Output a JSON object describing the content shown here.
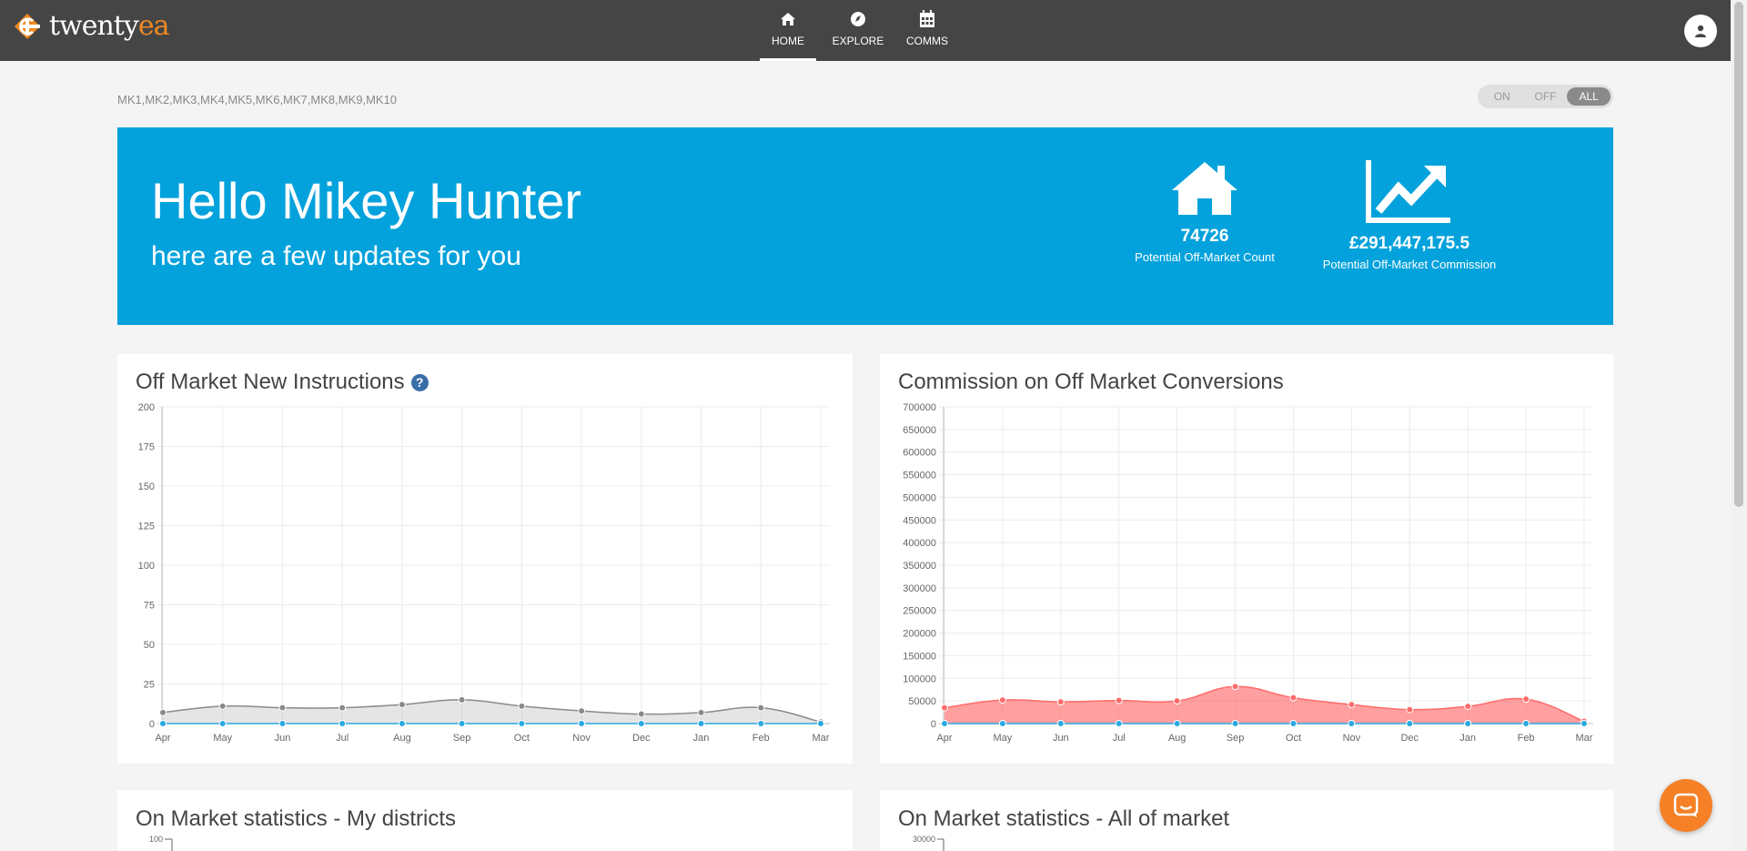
{
  "app": {
    "logo_word": "twenty",
    "logo_accent": "ea"
  },
  "nav": [
    {
      "label": "HOME",
      "icon": "home-icon",
      "active": true
    },
    {
      "label": "EXPLORE",
      "icon": "compass-icon",
      "active": false
    },
    {
      "label": "COMMS",
      "icon": "calendar-icon",
      "active": false
    }
  ],
  "filters": {
    "districts": "MK1,MK2,MK3,MK4,MK5,MK6,MK7,MK8,MK9,MK10",
    "toggle_options": [
      "ON",
      "OFF",
      "ALL"
    ],
    "toggle_selected": "ALL"
  },
  "hero": {
    "greeting": "Hello Mikey Hunter",
    "subtitle": "here are a few updates for you",
    "stats": [
      {
        "icon": "house-icon",
        "value": "74726",
        "label": "Potential Off-Market Count"
      },
      {
        "icon": "trend-up-icon",
        "value": "£291,447,175.5",
        "label": "Potential Off-Market Commission"
      }
    ]
  },
  "cards": {
    "off_market_title": "Off Market New Instructions",
    "commission_title": "Commission on Off Market Conversions",
    "my_districts_title": "On Market statistics - My districts",
    "all_market_title": "On Market statistics - All of market",
    "my_districts_first_tick": "100",
    "all_market_first_tick": "30000"
  },
  "colors": {
    "hero_bg": "#04a2dc",
    "topbar": "#454545",
    "chart1_line": "#8a8a8a",
    "chart2_line": "#ff6b6b",
    "baseline_series": "#2aa9e0",
    "chat_button": "#f58025"
  },
  "chart_data": [
    {
      "type": "area",
      "title": "Off Market New Instructions",
      "categories": [
        "Apr",
        "May",
        "Jun",
        "Jul",
        "Aug",
        "Sep",
        "Oct",
        "Nov",
        "Dec",
        "Jan",
        "Feb",
        "Mar"
      ],
      "ylim": [
        0,
        200
      ],
      "yticks": [
        0,
        25,
        50,
        75,
        100,
        125,
        150,
        175,
        200
      ],
      "grid": true,
      "series": [
        {
          "values": [
            7,
            11,
            10,
            10,
            12,
            15,
            11,
            8,
            6,
            7,
            10,
            1
          ],
          "color": "#8a8a8a"
        },
        {
          "values": [
            0,
            0,
            0,
            0,
            0,
            0,
            0,
            0,
            0,
            0,
            0,
            0
          ],
          "color": "#2aa9e0"
        }
      ]
    },
    {
      "type": "area",
      "title": "Commission on Off Market Conversions",
      "categories": [
        "Apr",
        "May",
        "Jun",
        "Jul",
        "Aug",
        "Sep",
        "Oct",
        "Nov",
        "Dec",
        "Jan",
        "Feb",
        "Mar"
      ],
      "ylim": [
        0,
        700000
      ],
      "yticks": [
        0,
        50000,
        100000,
        150000,
        200000,
        250000,
        300000,
        350000,
        400000,
        450000,
        500000,
        550000,
        600000,
        650000,
        700000
      ],
      "grid": true,
      "series": [
        {
          "values": [
            35000,
            52000,
            48000,
            51000,
            50000,
            82000,
            57000,
            42000,
            31000,
            38000,
            54000,
            5000
          ],
          "color": "#ff6b6b"
        },
        {
          "values": [
            0,
            0,
            0,
            0,
            0,
            0,
            0,
            0,
            0,
            0,
            0,
            0
          ],
          "color": "#2aa9e0"
        }
      ]
    }
  ]
}
